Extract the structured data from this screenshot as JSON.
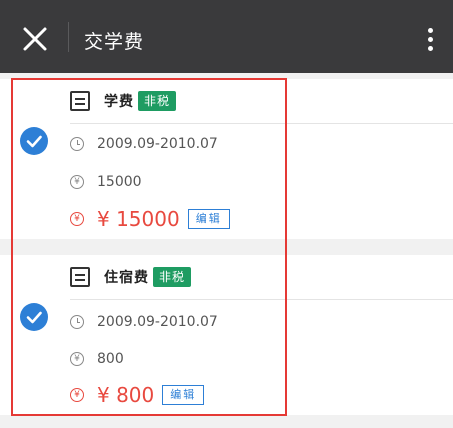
{
  "header": {
    "title": "交学费",
    "close_icon": "close-icon",
    "more_icon": "more-vertical-icon"
  },
  "items": [
    {
      "name": "学费",
      "tag": "非税",
      "period": "2009.09-2010.07",
      "base_amount": "15000",
      "amount": "¥ 15000",
      "edit_label": "编辑",
      "checked": true
    },
    {
      "name": "住宿费",
      "tag": "非税",
      "period": "2009.09-2010.07",
      "base_amount": "800",
      "amount": "¥ 800",
      "edit_label": "编辑",
      "checked": true
    }
  ],
  "icons": {
    "currency_symbol": "¥"
  },
  "colors": {
    "header_bg": "#3a3a3c",
    "check_blue": "#2d7fd6",
    "tag_green": "#1e9c62",
    "amount_red": "#e8493f",
    "highlight_red": "#e53935"
  }
}
